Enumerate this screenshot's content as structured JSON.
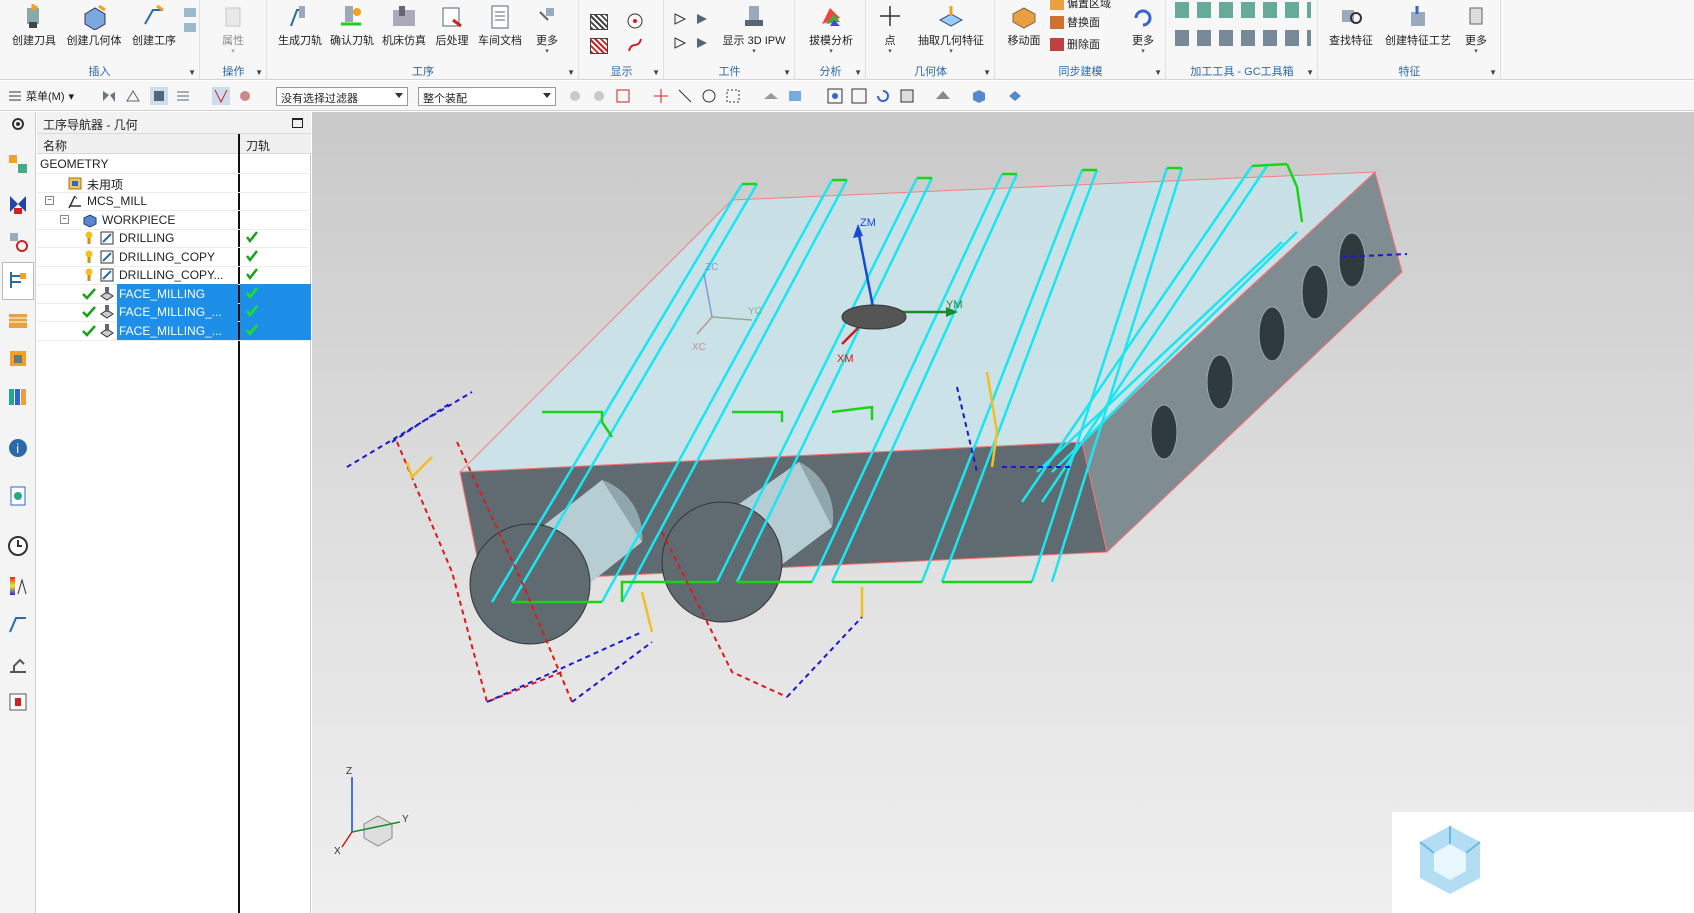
{
  "ribbon": {
    "insert": {
      "label": "插入",
      "create_tool": "创建刀具",
      "create_geometry": "创建几何体",
      "create_operation": "创建工序"
    },
    "actions": {
      "label": "操作",
      "properties": "属性"
    },
    "operation": {
      "label": "工序",
      "generate_path": "生成刀轨",
      "verify_path": "确认刀轨",
      "machine_sim": "机床仿真",
      "postprocess": "后处理",
      "shop_doc": "车间文档",
      "more": "更多"
    },
    "display": {
      "label": "显示"
    },
    "workpiece": {
      "label": "工件",
      "show_3d_ipw": "显示 3D IPW"
    },
    "analysis": {
      "label": "分析",
      "draft_analysis": "拔模分析"
    },
    "geometry": {
      "label": "几何体",
      "point": "点",
      "extract_features": "抽取几何特征"
    },
    "sync": {
      "label": "同步建模",
      "move_face": "移动面",
      "offset_region": "偏置区域",
      "replace_face": "替换面",
      "delete_face": "删除面",
      "more": "更多"
    },
    "gc": {
      "label": "加工工具 - GC工具箱"
    },
    "features": {
      "label": "特征",
      "find_features": "查找特征",
      "create_feature_process": "创建特征工艺",
      "more": "更多"
    }
  },
  "toolbar": {
    "menu_label": "菜单(M)",
    "filter_value": "没有选择过滤器",
    "assembly_value": "整个装配"
  },
  "navigator": {
    "title": "工序导航器 - 几何",
    "col_name": "名称",
    "col_path": "刀轨",
    "rows": [
      {
        "name": "GEOMETRY",
        "selected": false,
        "path": ""
      },
      {
        "name": "未用项",
        "selected": false,
        "path": ""
      },
      {
        "name": "MCS_MILL",
        "selected": false,
        "path": ""
      },
      {
        "name": "WORKPIECE",
        "selected": false,
        "path": ""
      },
      {
        "name": "DRILLING",
        "selected": false,
        "path": "✔"
      },
      {
        "name": "DRILLING_COPY",
        "selected": false,
        "path": "✔"
      },
      {
        "name": "DRILLING_COPY...",
        "selected": false,
        "path": "✔"
      },
      {
        "name": "FACE_MILLING",
        "selected": true,
        "path": "✔"
      },
      {
        "name": "FACE_MILLING_...",
        "selected": true,
        "path": "✔"
      },
      {
        "name": "FACE_MILLING_...",
        "selected": true,
        "path": "✔"
      }
    ]
  },
  "viewport": {
    "axes": {
      "zm": "ZM",
      "ym": "YM",
      "xm": "XM",
      "zc": "ZC",
      "yc": "YC",
      "xc": "XC",
      "triad_z": "Z",
      "triad_y": "Y",
      "triad_x": "X"
    },
    "colors": {
      "toolpath_cyan": "#19e6f0",
      "toolpath_green": "#19d419",
      "rapid_blue": "#1a1ad0",
      "rapid_red": "#e01818",
      "part_gray": "#5f6b70",
      "top_face": "#c9e4ec"
    }
  }
}
